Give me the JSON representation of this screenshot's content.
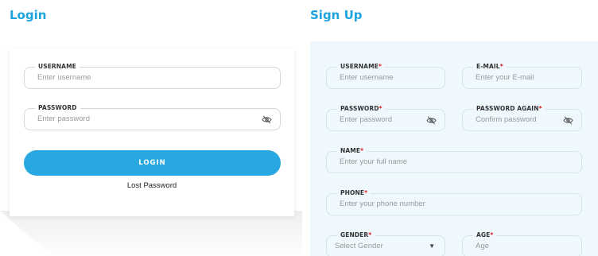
{
  "login": {
    "title": "Login",
    "username": {
      "label": "USERNAME",
      "placeholder": "Enter username"
    },
    "password": {
      "label": "PASSWORD",
      "placeholder": "Enter password"
    },
    "button_label": "LOGIN",
    "lost_password": "Lost Password"
  },
  "signup": {
    "title": "Sign Up",
    "required_mark": "*",
    "username": {
      "label": "USERNAME",
      "placeholder": "Enter username"
    },
    "email": {
      "label": "E-MAIL",
      "placeholder": "Enter your E-mail"
    },
    "password": {
      "label": "PASSWORD",
      "placeholder": "Enter password"
    },
    "password_again": {
      "label": "PASSWORD AGAIN",
      "placeholder": "Confirm password"
    },
    "name": {
      "label": "NAME",
      "placeholder": "Enter your full name"
    },
    "phone": {
      "label": "PHONE",
      "placeholder": "Enter your phone number"
    },
    "gender": {
      "label": "GENDER",
      "placeholder": "Select Gender"
    },
    "age": {
      "label": "AGE",
      "placeholder": "Age"
    }
  },
  "icons": {
    "password_visibility": "eye-off-icon",
    "dropdown": "chevron-down-icon"
  },
  "colors": {
    "accent": "#27a8e0",
    "heading": "#1da4de",
    "required": "#e21c1c",
    "signup_background": "#eef8fd"
  }
}
